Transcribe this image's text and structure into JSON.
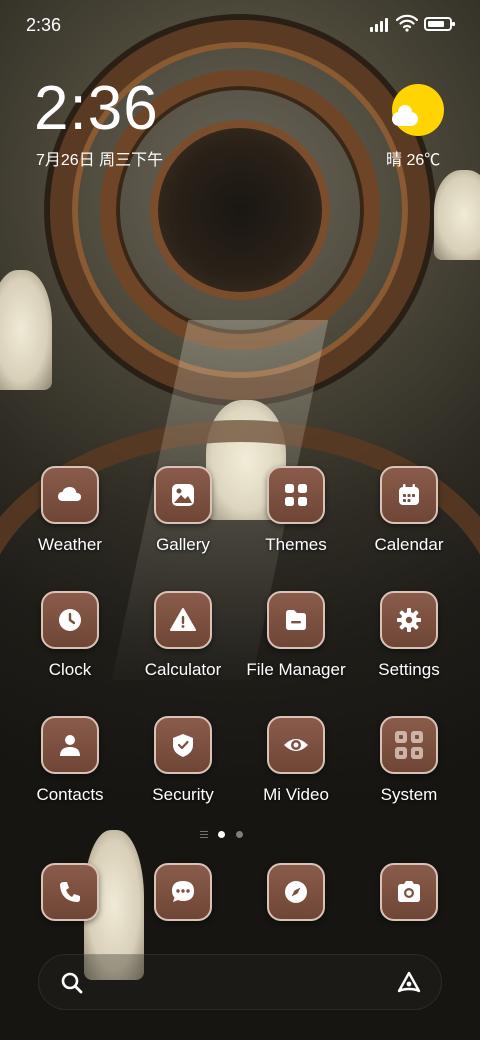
{
  "status_bar": {
    "time": "2:36",
    "battery_level": 0.8
  },
  "clock_widget": {
    "time": "2:36",
    "date": "7月26日 周三下午",
    "weather": "晴 26℃",
    "weather_icon": "sun-cloud-icon"
  },
  "apps": [
    {
      "label": "Weather",
      "icon": "cloud-icon"
    },
    {
      "label": "Gallery",
      "icon": "image-icon"
    },
    {
      "label": "Themes",
      "icon": "grid-icon"
    },
    {
      "label": "Calendar",
      "icon": "calendar-icon"
    },
    {
      "label": "Clock",
      "icon": "clock-icon"
    },
    {
      "label": "Calculator",
      "icon": "warning-icon"
    },
    {
      "label": "File Manager",
      "icon": "folder-icon"
    },
    {
      "label": "Settings",
      "icon": "gear-icon"
    },
    {
      "label": "Contacts",
      "icon": "person-icon"
    },
    {
      "label": "Security",
      "icon": "shield-icon"
    },
    {
      "label": "Mi Video",
      "icon": "eye-icon"
    },
    {
      "label": "System",
      "icon": "folder-grid-icon"
    }
  ],
  "dock": [
    {
      "icon": "phone-icon"
    },
    {
      "icon": "message-icon"
    },
    {
      "icon": "compass-icon"
    },
    {
      "icon": "camera-icon"
    }
  ],
  "pager": {
    "pages": 2,
    "current": 1
  },
  "search": {
    "icon": "search-icon",
    "assistant_icon": "assistant-icon"
  },
  "colors": {
    "icon_bg": "#7a4f3e",
    "icon_border": "#d9c3b7",
    "sun": "#ffd400"
  }
}
